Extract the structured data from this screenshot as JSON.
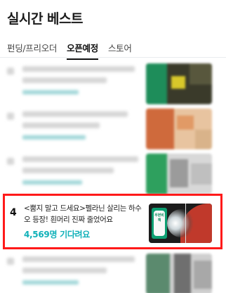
{
  "page": {
    "title": "실시간 베스트"
  },
  "tabs": [
    {
      "label": "펀딩/프리오더",
      "active": false
    },
    {
      "label": "오픈예정",
      "active": true
    },
    {
      "label": "스토어",
      "active": false
    }
  ],
  "highlighted_item": {
    "rank": "4",
    "title": "<뿜지 말고 드세요>펠라닌 살리는 하수오 등장! 흰머리 진짜 줄었어요",
    "count": "4,569명 기다려요",
    "thumbnail_badge": "우븐비책"
  },
  "colors": {
    "accent": "#11b1b9",
    "highlight_border": "#ff1a1a"
  }
}
